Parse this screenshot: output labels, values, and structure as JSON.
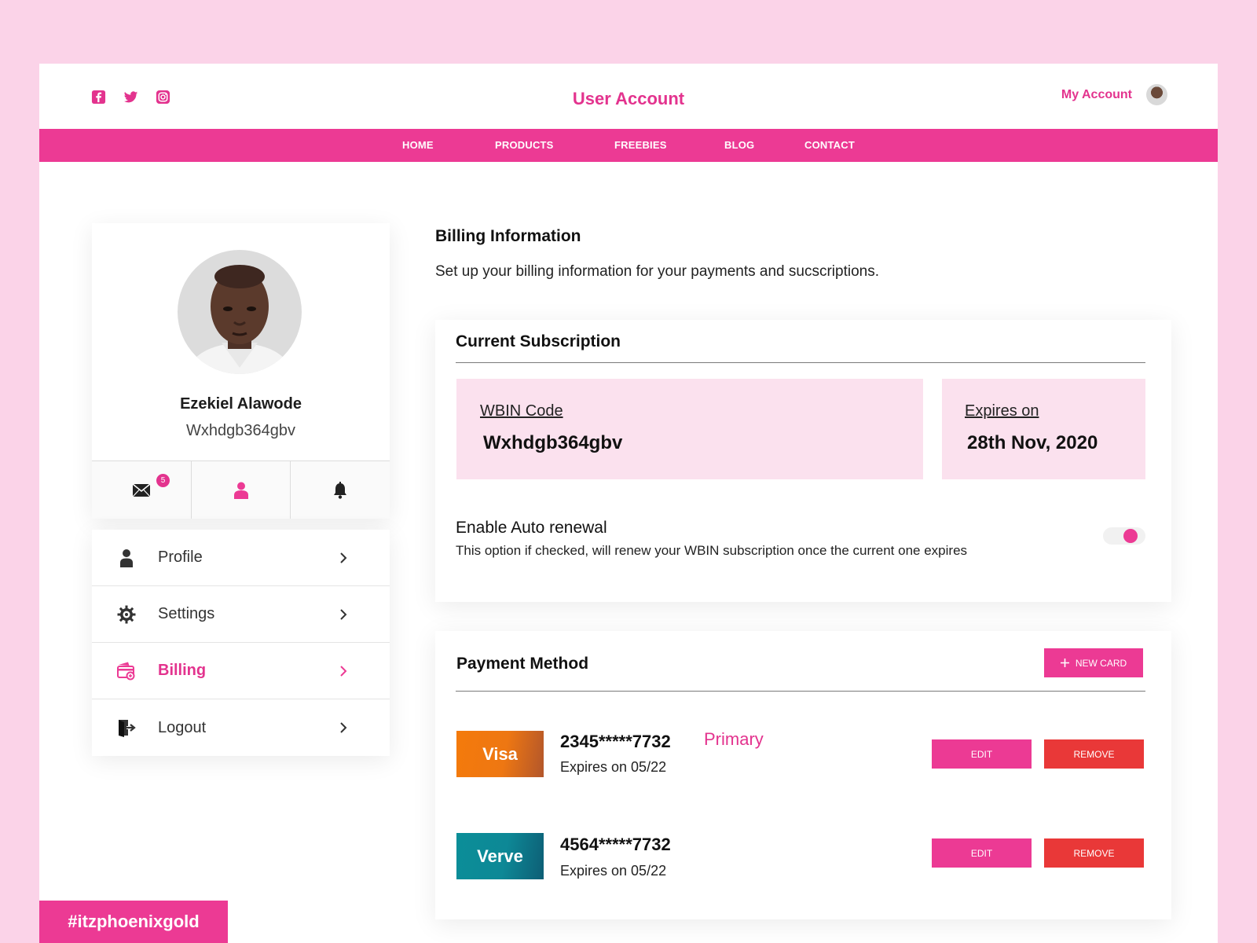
{
  "colors": {
    "accent": "#ec3a94",
    "accent_text": "#e3338e",
    "danger": "#e93838",
    "page_bg": "#fbd3e8",
    "info_bg": "#fbe1ee"
  },
  "header": {
    "social_icons": [
      "facebook-icon",
      "twitter-icon",
      "instagram-icon"
    ],
    "title": "User Account",
    "account_label": "My Account"
  },
  "nav": {
    "items": [
      "HOME",
      "PRODUCTS",
      "FREEBIES",
      "BLOG",
      "CONTACT"
    ]
  },
  "profile": {
    "name": "Ezekiel Alawode",
    "code": "Wxhdgb364gbv",
    "mail_badge": "5",
    "quick_icons": [
      "mail-icon",
      "user-icon",
      "bell-icon"
    ]
  },
  "menu": {
    "items": [
      {
        "label": "Profile",
        "icon": "user-icon"
      },
      {
        "label": "Settings",
        "icon": "gear-icon"
      },
      {
        "label": "Billing",
        "icon": "billing-icon",
        "active": true
      },
      {
        "label": "Logout",
        "icon": "logout-icon"
      }
    ]
  },
  "billing": {
    "title": "Billing Information",
    "description": "Set up your billing information for your payments and sucscriptions."
  },
  "subscription": {
    "heading": "Current Subscription",
    "wbin_label": "WBIN Code",
    "wbin_value": "Wxhdgb364gbv",
    "expires_label": "Expires on",
    "expires_value": "28th Nov, 2020",
    "renew_title": "Enable Auto renewal",
    "renew_desc": "This option if checked, will renew your WBIN subscription once the current one expires",
    "auto_renew_enabled": true
  },
  "payment": {
    "heading": "Payment Method",
    "new_card_label": "NEW CARD",
    "cards": [
      {
        "brand": "Visa",
        "number": "2345*****7732",
        "expires": "Expires on 05/22",
        "primary_label": "Primary",
        "edit_label": "EDIT",
        "remove_label": "REMOVE"
      },
      {
        "brand": "Verve",
        "number": "4564*****7732",
        "expires": "Expires on 05/22",
        "edit_label": "EDIT",
        "remove_label": "REMOVE"
      }
    ]
  },
  "watermark": "#itzphoenixgold"
}
